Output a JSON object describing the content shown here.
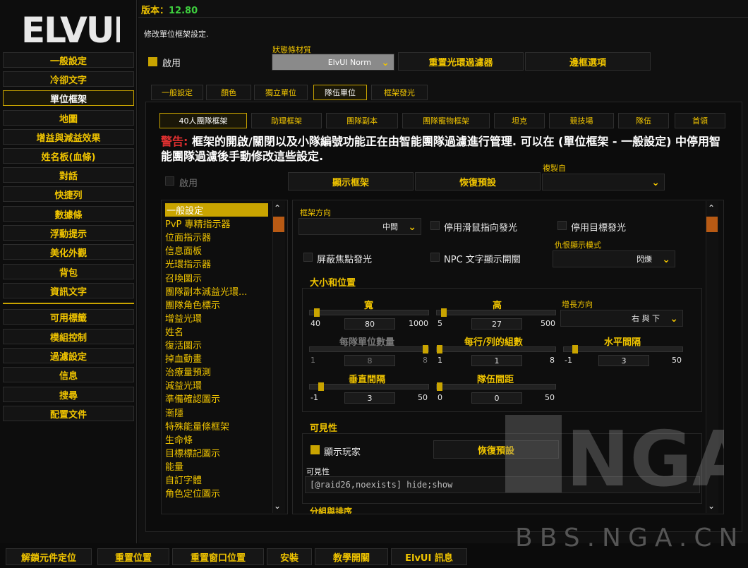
{
  "version_label": "版本：",
  "version_value": "12.80",
  "logo_text": "ELVUI",
  "sidebar": {
    "items": [
      "一般設定",
      "冷卻文字",
      "單位框架",
      "地圖",
      "增益與減益效果",
      "姓名板(血條)",
      "對話",
      "快捷列",
      "數據條",
      "浮動提示",
      "美化外觀",
      "背包",
      "資訊文字"
    ],
    "items2": [
      "可用標籤",
      "模組控制",
      "過濾設定",
      "信息",
      "搜尋",
      "配置文件"
    ],
    "active_index": 2
  },
  "page_desc": "修改單位框架設定.",
  "enable_label": "啟用",
  "statusbar_label": "狀態條材質",
  "statusbar_value": "ElvUI Norm",
  "reset_aura_filter": "重置光環過濾器",
  "border_options": "邊框選項",
  "tabs": [
    "一般設定",
    "顏色",
    "獨立單位",
    "隊伍單位",
    "框架發光"
  ],
  "active_tab": 3,
  "subtabs": [
    "40人團隊框架",
    "助理框架",
    "團隊副本",
    "團隊寵物框架",
    "坦克",
    "競技場",
    "隊伍",
    "首領"
  ],
  "active_subtab": 0,
  "warning_prefix": "警告:",
  "warning_text": " 框架的開啟/關閉以及小隊編號功能正在由智能團隊過濾進行管理. 可以在 (單位框架 - 一般設定) 中停用智能團隊過濾後手動修改這些設定.",
  "enable2_label": "啟用",
  "show_frames": "顯示框架",
  "restore_defaults": "恢復預設",
  "copy_from_label": "複製自",
  "nav": [
    "一般設定",
    "PvP 專精指示器",
    "位面指示器",
    "信息面板",
    "光環指示器",
    "召喚圖示",
    "團隊副本減益光環...",
    "團隊角色標示",
    "增益光環",
    "姓名",
    "復活圖示",
    "掉血動畫",
    "治療量預測",
    "減益光環",
    "準備確認圖示",
    "漸隱",
    "特殊能量條框架",
    "生命條",
    "目標標記圖示",
    "能量",
    "自訂字體",
    "角色定位圖示"
  ],
  "frame_dir_label": "框架方向",
  "frame_dir_value": "中間",
  "disable_mouseover_glow": "停用滑鼠指向發光",
  "disable_target_glow": "停用目標發光",
  "hide_focus_glow": "屏蔽焦點發光",
  "npc_text_toggle": "NPC 文字顯示開關",
  "threat_mode_label": "仇恨顯示模式",
  "threat_mode_value": "閃爍",
  "size_pos_header": "大小和位置",
  "width_label": "寬",
  "width_min": "40",
  "width_val": "80",
  "width_max": "1000",
  "height_label": "高",
  "height_min": "5",
  "height_val": "27",
  "height_max": "500",
  "growth_dir_label": "增長方向",
  "growth_dir_value": "右 與 下",
  "units_per_group_label": "每隊單位數量",
  "upg_min": "1",
  "upg_val": "8",
  "upg_max": "8",
  "groups_per_row_label": "每行/列的組數",
  "gpr_min": "1",
  "gpr_val": "1",
  "gpr_max": "8",
  "h_spacing_label": "水平間隔",
  "hs_min": "-1",
  "hs_val": "3",
  "hs_max": "50",
  "v_spacing_label": "垂直間隔",
  "vs_min": "-1",
  "vs_val": "3",
  "vs_max": "50",
  "group_spacing_label": "隊伍間距",
  "gs_min": "0",
  "gs_val": "0",
  "gs_max": "50",
  "visibility_header": "可見性",
  "show_player": "顯示玩家",
  "restore_defaults2": "恢復預設",
  "visibility_label": "可見性",
  "visibility_value": "[@raid26,noexists] hide;show",
  "group_sort_header": "分組與排序",
  "bottom": [
    "解鎖元件定位",
    "重置位置",
    "重置窗口位置",
    "安裝",
    "教學開關",
    "ElvUI 訊息"
  ],
  "watermark_logo": "NGA",
  "watermark_url": "BBS.NGA.CN",
  "colors": {
    "accent": "#c9a400",
    "text": "#f0c400",
    "warning": "#e03030"
  }
}
